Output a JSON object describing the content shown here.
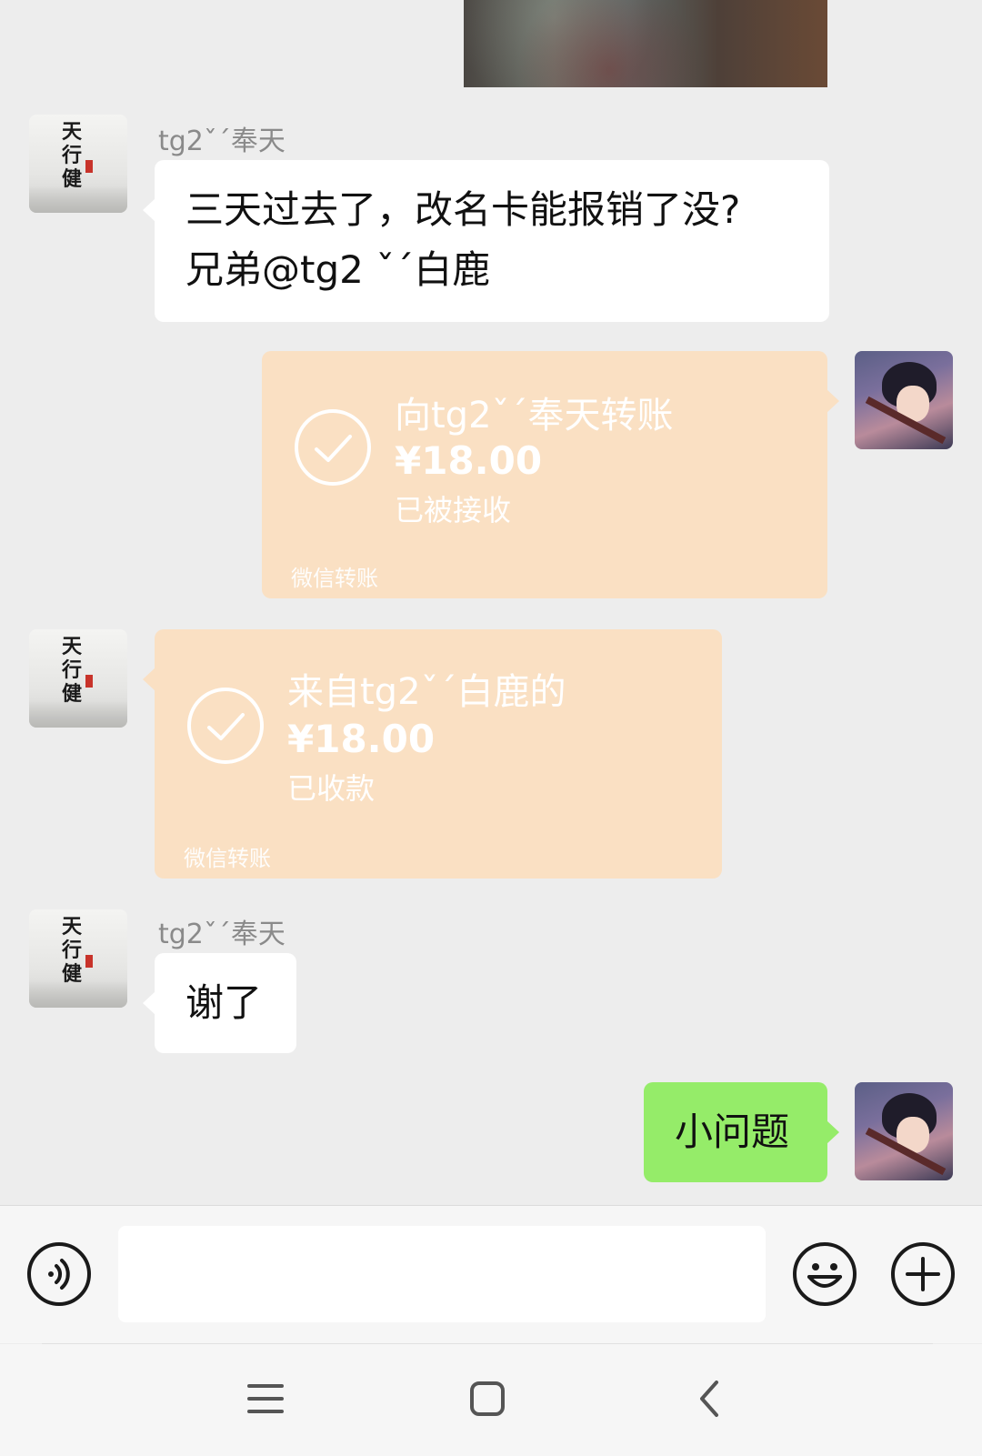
{
  "chat": {
    "messages": [
      {
        "sender": "tg2ˇˊ奉天",
        "kind": "text",
        "lines": [
          "三天过去了，改名卡能报销了没?",
          "兄弟@tg2 ˇˊ白鹿"
        ]
      },
      {
        "sender": "me",
        "kind": "transfer",
        "title": "向tg2ˇˊ奉天转账",
        "amount": "¥18.00",
        "status": "已被接收",
        "footer": "微信转账"
      },
      {
        "sender": "tg2ˇˊ奉天",
        "kind": "transfer",
        "title": "来自tg2ˇˊ白鹿的",
        "amount": "¥18.00",
        "status": "已收款",
        "footer": "微信转账"
      },
      {
        "sender": "tg2ˇˊ奉天",
        "kind": "text",
        "lines": [
          "谢了"
        ]
      },
      {
        "sender": "me",
        "kind": "text",
        "lines": [
          "小问题"
        ]
      }
    ]
  },
  "composer": {
    "input_value": "",
    "voice_icon": "voice-icon",
    "emoji_icon": "emoji-icon",
    "plus_icon": "plus-icon"
  },
  "navbar": {
    "menu_icon": "menu-icon",
    "home_icon": "home-icon",
    "back_icon": "back-icon"
  },
  "colors": {
    "background": "#ededed",
    "incoming_bubble": "#ffffff",
    "outgoing_bubble": "#95ec69",
    "transfer_bubble": "#fae0c3"
  }
}
